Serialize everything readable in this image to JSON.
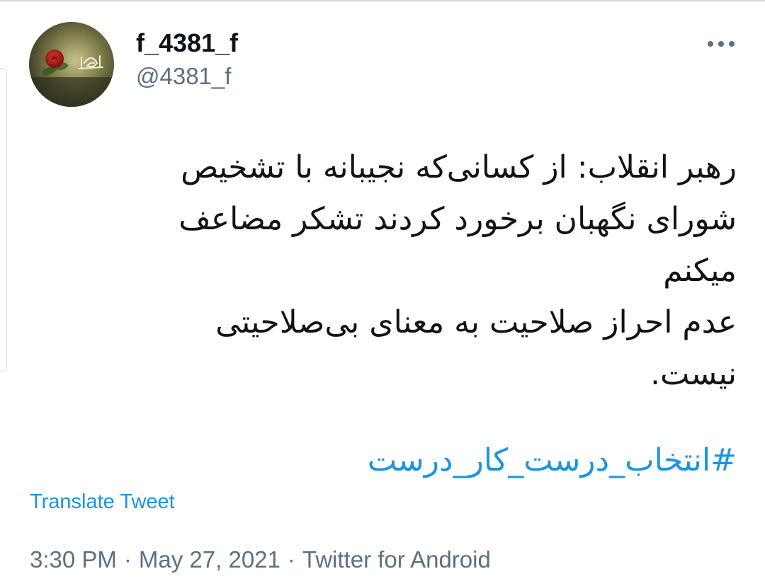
{
  "author": {
    "display_name": "f_4381_f",
    "handle": "@4381_f",
    "avatar_icon": "avatar-rose-calligraphy-icon",
    "avatar_calligraphy": "الحمدلله"
  },
  "tweet": {
    "text_lines": [
      "رهبر انقلاب: از کسانی‌که نجیبانه با تشخیص",
      "شورای نگهبان برخورد کردند تشکر مضاعف",
      "میکنم",
      " عدم احراز صلاحیت به معنای بی‌صلاحیتی",
      "نیست."
    ],
    "hashtag": "#انتخاب_درست_کار_درست"
  },
  "actions": {
    "more_icon": "more-horizontal-icon",
    "translate_label": "Translate Tweet"
  },
  "meta": {
    "time": "3:30 PM",
    "separator": "·",
    "date": "May 27, 2021",
    "source": "Twitter for Android"
  },
  "colors": {
    "link": "#1b95e0",
    "secondary_text": "#5b7083",
    "primary_text": "#0f1419"
  }
}
